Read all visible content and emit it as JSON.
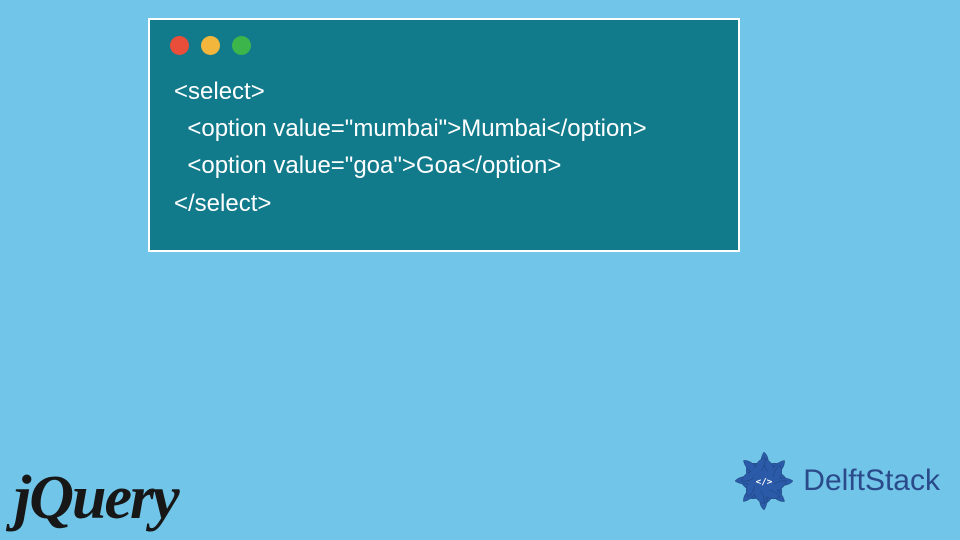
{
  "window": {
    "buttons": {
      "close_color": "#e94e3a",
      "minimize_color": "#f2b63c",
      "zoom_color": "#3cb64b"
    }
  },
  "code": {
    "line1": "<select>",
    "line2": "  <option value=\"mumbai\">Mumbai</option>",
    "line3": "  <option value=\"goa\">Goa</option>",
    "line4": "</select>"
  },
  "logos": {
    "jquery": "jQuery",
    "delftstack": "DelftStack"
  }
}
